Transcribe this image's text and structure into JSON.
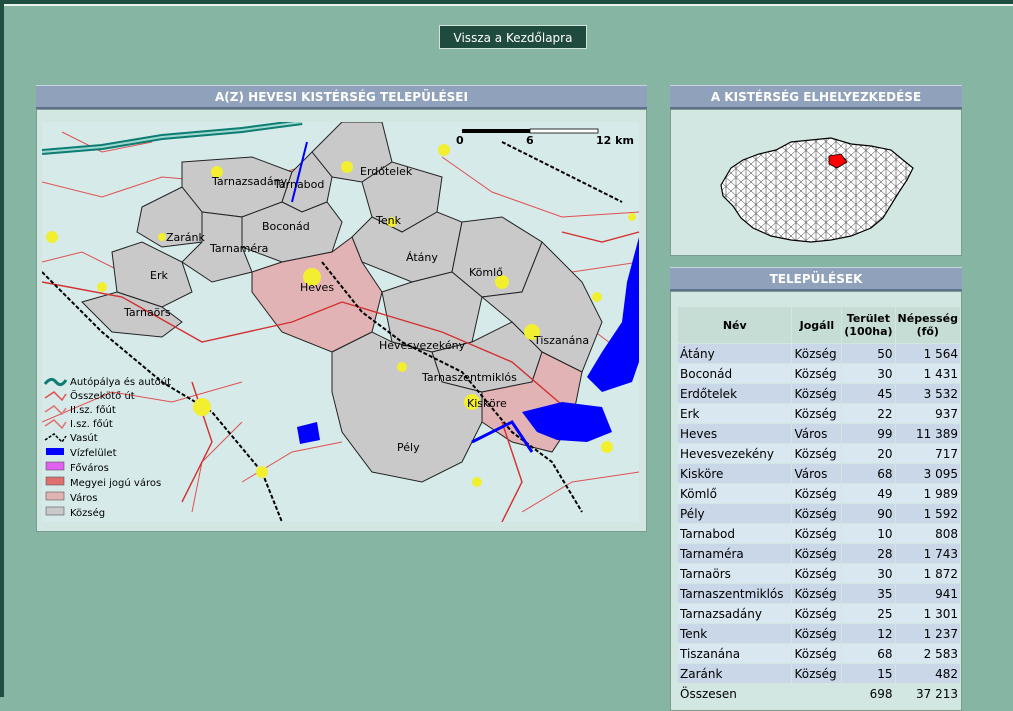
{
  "nav": {
    "back_label": "Vissza a Kezdőlapra"
  },
  "map_panel": {
    "title": "A(Z) HEVESI KISTÉRSÉG TELEPÜLÉSEI",
    "scale": {
      "start": "0",
      "mid": "6",
      "end": "12 km"
    },
    "places": [
      "Erdőtelek",
      "Tarnazsadány",
      "Tarnabod",
      "Tenk",
      "Boconád",
      "Zaránk",
      "Tarnaméra",
      "Átány",
      "Kömlő",
      "Erk",
      "Heves",
      "Tarnaörs",
      "Tiszanána",
      "Hevesvezekény",
      "Tarnaszentmiklós",
      "Kisköre",
      "Pély"
    ],
    "legend": [
      "Autópálya és autóút",
      "Összekötő út",
      "II.sz. főút",
      "I.sz. főút",
      "Vasút",
      "Vízfelület",
      "Főváros",
      "Megyei jogú város",
      "Város",
      "Község"
    ]
  },
  "location_panel": {
    "title": "A KISTÉRSÉG ELHELYEZKEDÉSE"
  },
  "settlements_panel": {
    "title": "TELEPÜLÉSEK",
    "columns": [
      "Név",
      "Jogáll",
      "Terület (100ha)",
      "Népesség (fő)"
    ],
    "rows": [
      [
        "Átány",
        "Község",
        "50",
        "1 564"
      ],
      [
        "Boconád",
        "Község",
        "30",
        "1 431"
      ],
      [
        "Erdőtelek",
        "Község",
        "45",
        "3 532"
      ],
      [
        "Erk",
        "Község",
        "22",
        "937"
      ],
      [
        "Heves",
        "Város",
        "99",
        "11 389"
      ],
      [
        "Hevesvezekény",
        "Község",
        "20",
        "717"
      ],
      [
        "Kisköre",
        "Város",
        "68",
        "3 095"
      ],
      [
        "Kömlő",
        "Község",
        "49",
        "1 989"
      ],
      [
        "Pély",
        "Község",
        "90",
        "1 592"
      ],
      [
        "Tarnabod",
        "Község",
        "10",
        "808"
      ],
      [
        "Tarnaméra",
        "Község",
        "28",
        "1 743"
      ],
      [
        "Tarnaörs",
        "Község",
        "30",
        "1 872"
      ],
      [
        "Tarnaszentmiklós",
        "Község",
        "35",
        "941"
      ],
      [
        "Tarnazsadány",
        "Község",
        "25",
        "1 301"
      ],
      [
        "Tenk",
        "Község",
        "12",
        "1 237"
      ],
      [
        "Tiszanána",
        "Község",
        "68",
        "2 583"
      ],
      [
        "Zaránk",
        "Község",
        "15",
        "482"
      ]
    ],
    "total": [
      "Összesen",
      "",
      "698",
      "37 213"
    ]
  },
  "colors": {
    "background": "#86b5a3",
    "panel_header": "#8fa1bb",
    "button": "#1e4b3d",
    "city_fill": "#e2b3b5",
    "village_fill": "#c9c9c9",
    "water": "#0000ff"
  }
}
